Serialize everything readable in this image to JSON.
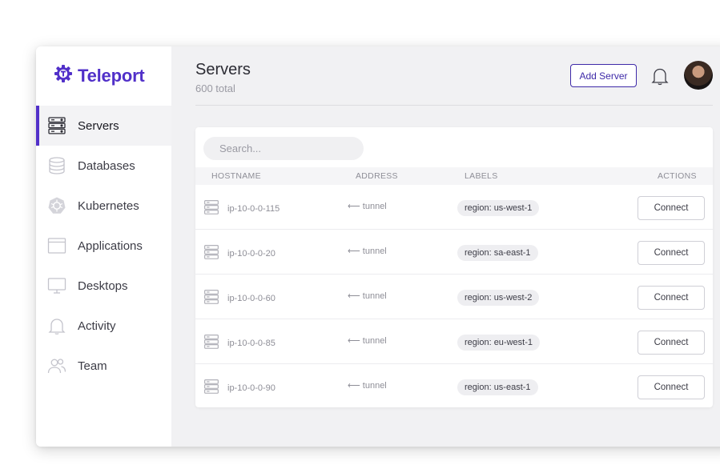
{
  "brand": {
    "name": "Teleport",
    "color": "#5130c9"
  },
  "sidebar": {
    "items": [
      {
        "label": "Servers",
        "icon": "server-icon",
        "active": true
      },
      {
        "label": "Databases",
        "icon": "database-icon",
        "active": false
      },
      {
        "label": "Kubernetes",
        "icon": "kubernetes-icon",
        "active": false
      },
      {
        "label": "Applications",
        "icon": "application-window-icon",
        "active": false
      },
      {
        "label": "Desktops",
        "icon": "desktop-monitor-icon",
        "active": false
      },
      {
        "label": "Activity",
        "icon": "bell-icon",
        "active": false
      },
      {
        "label": "Team",
        "icon": "users-icon",
        "active": false
      }
    ]
  },
  "header": {
    "title": "Servers",
    "subtitle": "600 total",
    "add_button": "Add Server"
  },
  "search": {
    "placeholder": "Search..."
  },
  "table": {
    "columns": {
      "hostname": "HOSTNAME",
      "address": "ADDRESS",
      "labels": "LABELS",
      "actions": "ACTIONS"
    },
    "rows": [
      {
        "hostname": "ip-10-0-0-115",
        "address": "tunnel",
        "label": "region: us-west-1",
        "action": "Connect"
      },
      {
        "hostname": "ip-10-0-0-20",
        "address": "tunnel",
        "label": "region: sa-east-1",
        "action": "Connect"
      },
      {
        "hostname": "ip-10-0-0-60",
        "address": "tunnel",
        "label": "region: us-west-2",
        "action": "Connect"
      },
      {
        "hostname": "ip-10-0-0-85",
        "address": "tunnel",
        "label": "region: eu-west-1",
        "action": "Connect"
      },
      {
        "hostname": "ip-10-0-0-90",
        "address": "tunnel",
        "label": "region: us-east-1",
        "action": "Connect"
      }
    ]
  }
}
